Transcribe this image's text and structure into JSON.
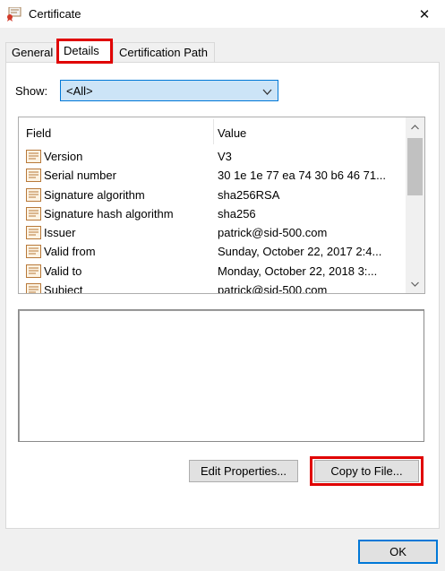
{
  "window": {
    "title": "Certificate",
    "close_glyph": "✕"
  },
  "tabs": [
    {
      "label": "General"
    },
    {
      "label": "Details"
    },
    {
      "label": "Certification Path"
    }
  ],
  "show": {
    "label": "Show:",
    "selected": "<All>"
  },
  "fields_table": {
    "headers": {
      "field": "Field",
      "value": "Value"
    },
    "rows": [
      {
        "field": "Version",
        "value": "V3"
      },
      {
        "field": "Serial number",
        "value": "30 1e 1e 77 ea 74 30 b6 46 71..."
      },
      {
        "field": "Signature algorithm",
        "value": "sha256RSA"
      },
      {
        "field": "Signature hash algorithm",
        "value": "sha256"
      },
      {
        "field": "Issuer",
        "value": "patrick@sid-500.com"
      },
      {
        "field": "Valid from",
        "value": "Sunday, October 22, 2017 2:4..."
      },
      {
        "field": "Valid to",
        "value": "Monday, October 22, 2018 3:..."
      },
      {
        "field": "Subject",
        "value": "patrick@sid-500.com"
      }
    ]
  },
  "buttons": {
    "edit_properties": "Edit Properties...",
    "copy_to_file": "Copy to File...",
    "ok": "OK"
  },
  "icons": {
    "app": "certificate-icon",
    "row": "certificate-field-icon"
  },
  "colors": {
    "highlight": "#e00000",
    "accent": "#0078d7",
    "selected_combo": "#cce4f7"
  }
}
